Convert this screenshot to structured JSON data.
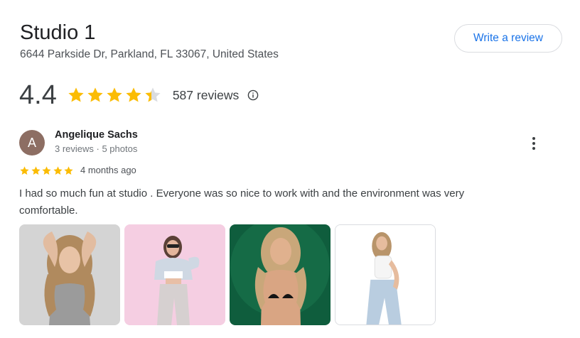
{
  "place": {
    "title": "Studio 1",
    "address": "6644 Parkside Dr, Parkland, FL 33067, United States"
  },
  "actions": {
    "write_review_label": "Write a review"
  },
  "rating": {
    "score": "4.4",
    "stars_value": 4.4,
    "stars_max": 5,
    "review_count_label": "587 reviews",
    "star_color": "#fbbc04",
    "empty_star_color": "#dadce0"
  },
  "review": {
    "avatar_letter": "A",
    "avatar_color": "#8d6e63",
    "reviewer_name": "Angelique Sachs",
    "reviewer_meta": "3 reviews · 5 photos",
    "stars_value": 5,
    "time_ago": "4 months ago",
    "text": "I had so much fun at studio . Everyone was so nice to work with and the environment was very comfortable.",
    "photos": [
      {
        "icon": "photo-gray-backdrop"
      },
      {
        "icon": "photo-pink-backdrop"
      },
      {
        "icon": "photo-green-backdrop"
      },
      {
        "icon": "photo-white-backdrop"
      }
    ]
  }
}
